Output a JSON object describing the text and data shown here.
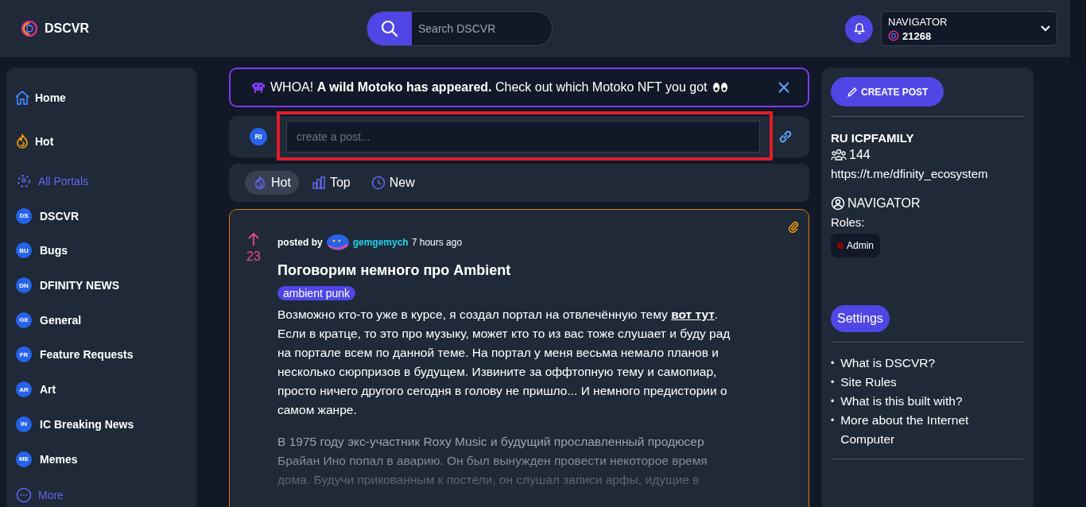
{
  "header": {
    "logo": "DSCVR",
    "search": {
      "placeholder": "Search DSCVR"
    },
    "user": {
      "name": "NAVIGATOR",
      "points": "21268"
    }
  },
  "sidebar": {
    "items": [
      {
        "kind": "home",
        "label": "Home"
      },
      {
        "kind": "hot",
        "label": "Hot"
      },
      {
        "kind": "portals",
        "label": "All Portals"
      },
      {
        "kind": "portal",
        "initials": "DS",
        "label": "DSCVR"
      },
      {
        "kind": "portal",
        "initials": "BU",
        "label": "Bugs"
      },
      {
        "kind": "portal",
        "initials": "DN",
        "label": "DFINITY NEWS"
      },
      {
        "kind": "portal",
        "initials": "GE",
        "label": "General"
      },
      {
        "kind": "portal",
        "initials": "FR",
        "label": "Feature Requests"
      },
      {
        "kind": "portal",
        "initials": "AR",
        "label": "Art"
      },
      {
        "kind": "portal",
        "initials": "IN",
        "label": "IC Breaking News"
      },
      {
        "kind": "portal",
        "initials": "ME",
        "label": "Memes"
      },
      {
        "kind": "more",
        "label": "More"
      }
    ]
  },
  "banner": {
    "text": "WHOA! **A wild Motoko has appeared.** Check out which Motoko NFT you got"
  },
  "composer": {
    "avatar": "RI",
    "placeholder": "create a post...",
    "highlighted": true
  },
  "tabs": [
    {
      "label": "Hot",
      "selected": true
    },
    {
      "label": "Top",
      "selected": false
    },
    {
      "label": "New",
      "selected": false
    }
  ],
  "post": {
    "votes": "23",
    "posted_by": "posted by",
    "author": "gemgemych",
    "time": "7 hours ago",
    "title": "Поговорим немного про Ambient",
    "tag": "ambient punk",
    "intro": {
      "before": "Возможно кто-то уже в курсе, я создал портал на отвлечённую тему ",
      "link": "вот тут",
      "after": ". Если в кратце, то это про музыку, может кто то из вас тоже слушает и буду рад на портале всем по данной теме. На портал у меня весьма немало планов и несколько сюрпризов в будущем. Извините за оффтопную тему и самопиар, просто ничего другого сегодня в голову не пришло... И немного предистории о самом жанре."
    },
    "continued": "В 1975 году экс-участник Roxy Music и будущий прославленный продюсер Брайан Ино попал в аварию. Он был вынужден провести некоторое время дома. Будучи прикованным к постели, он слушал записи арфы, идущие в"
  },
  "right_panel": {
    "button": "CREATE POST",
    "portal": "RU ICPFAMILY",
    "members": "144",
    "url": "https://t.me/dfinity_ecosystem",
    "owner": "NAVIGATOR",
    "roles_label": "Roles:",
    "roles": [
      {
        "name": "Admin",
        "color": "#8b0000"
      }
    ],
    "settings": "Settings",
    "links": [
      {
        "bullet": "•",
        "label": "What is DSCVR?"
      },
      {
        "bullet": "•",
        "label": "Site Rules"
      },
      {
        "bullet": "•",
        "label": "What is this built with?"
      },
      {
        "bullet": "•",
        "label": "More about the Internet Computer"
      }
    ]
  }
}
